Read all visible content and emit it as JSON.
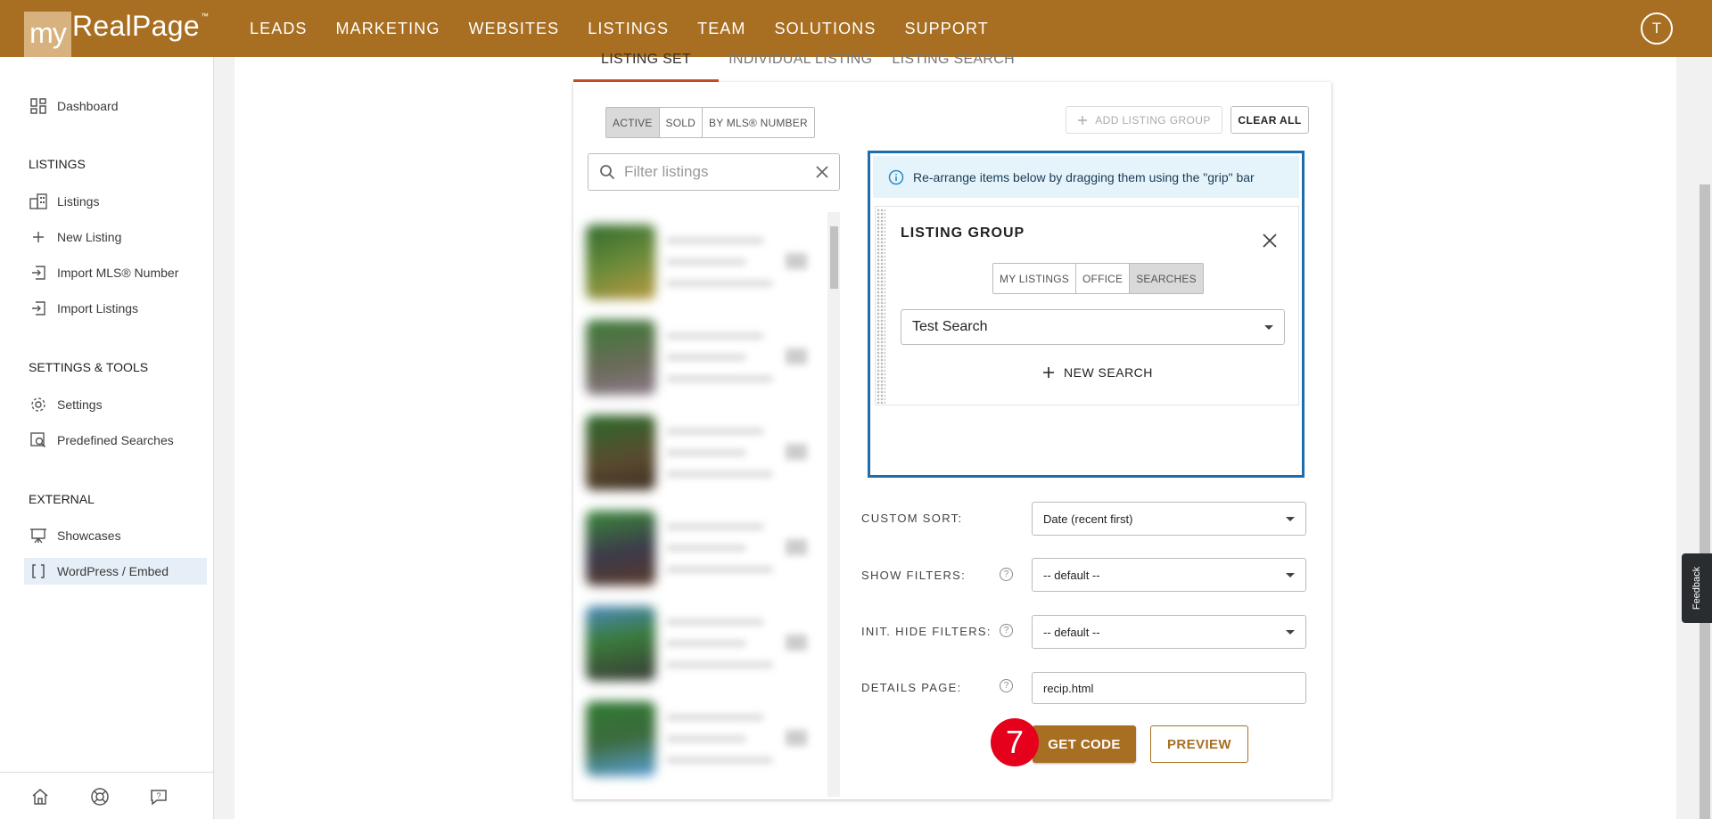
{
  "app": {
    "logo_box": "my",
    "logo_text": "RealPage",
    "logo_tm": "™"
  },
  "nav": [
    "LEADS",
    "MARKETING",
    "WEBSITES",
    "LISTINGS",
    "TEAM",
    "SOLUTIONS",
    "SUPPORT"
  ],
  "user": {
    "initial": "T"
  },
  "sidebar": {
    "dashboard": "Dashboard",
    "listings_head": "LISTINGS",
    "listings": [
      "Listings",
      "New Listing",
      "Import MLS® Number",
      "Import Listings"
    ],
    "settings_head": "SETTINGS & TOOLS",
    "settings": [
      "Settings",
      "Predefined Searches"
    ],
    "external_head": "EXTERNAL",
    "external": [
      "Showcases",
      "WordPress / Embed"
    ]
  },
  "tabs": [
    "LISTING SET",
    "INDIVIDUAL LISTING",
    "LISTING SEARCH"
  ],
  "status_filter": {
    "options": [
      "ACTIVE",
      "SOLD",
      "BY MLS® NUMBER"
    ],
    "selected": "ACTIVE"
  },
  "filter": {
    "placeholder": "Filter listings"
  },
  "actions": {
    "add_group": "ADD LISTING GROUP",
    "clear_all": "CLEAR ALL"
  },
  "info_text": "Re-arrange items below by dragging them using the \"grip\" bar",
  "listing_group": {
    "title": "LISTING GROUP",
    "source_options": [
      "MY LISTINGS",
      "OFFICE",
      "SEARCHES"
    ],
    "source_selected": "SEARCHES",
    "search_value": "Test Search",
    "new_search": "NEW SEARCH"
  },
  "fields": {
    "custom_sort": {
      "label": "CUSTOM SORT:",
      "value": "Date (recent first)"
    },
    "show_filters": {
      "label": "SHOW FILTERS:",
      "value": "-- default --"
    },
    "init_hide_filters": {
      "label": "INIT. HIDE FILTERS:",
      "value": "-- default --"
    },
    "details_page": {
      "label": "DETAILS PAGE:",
      "value": "recip.html"
    }
  },
  "buttons": {
    "get_code": "GET CODE",
    "preview": "PREVIEW"
  },
  "step_badge": "7",
  "feedback": "Feedback",
  "help_glyph": "?",
  "colors": {
    "brand": "#a86f22",
    "accent_blue": "#1d6dad",
    "step_badge": "#e5001b"
  }
}
